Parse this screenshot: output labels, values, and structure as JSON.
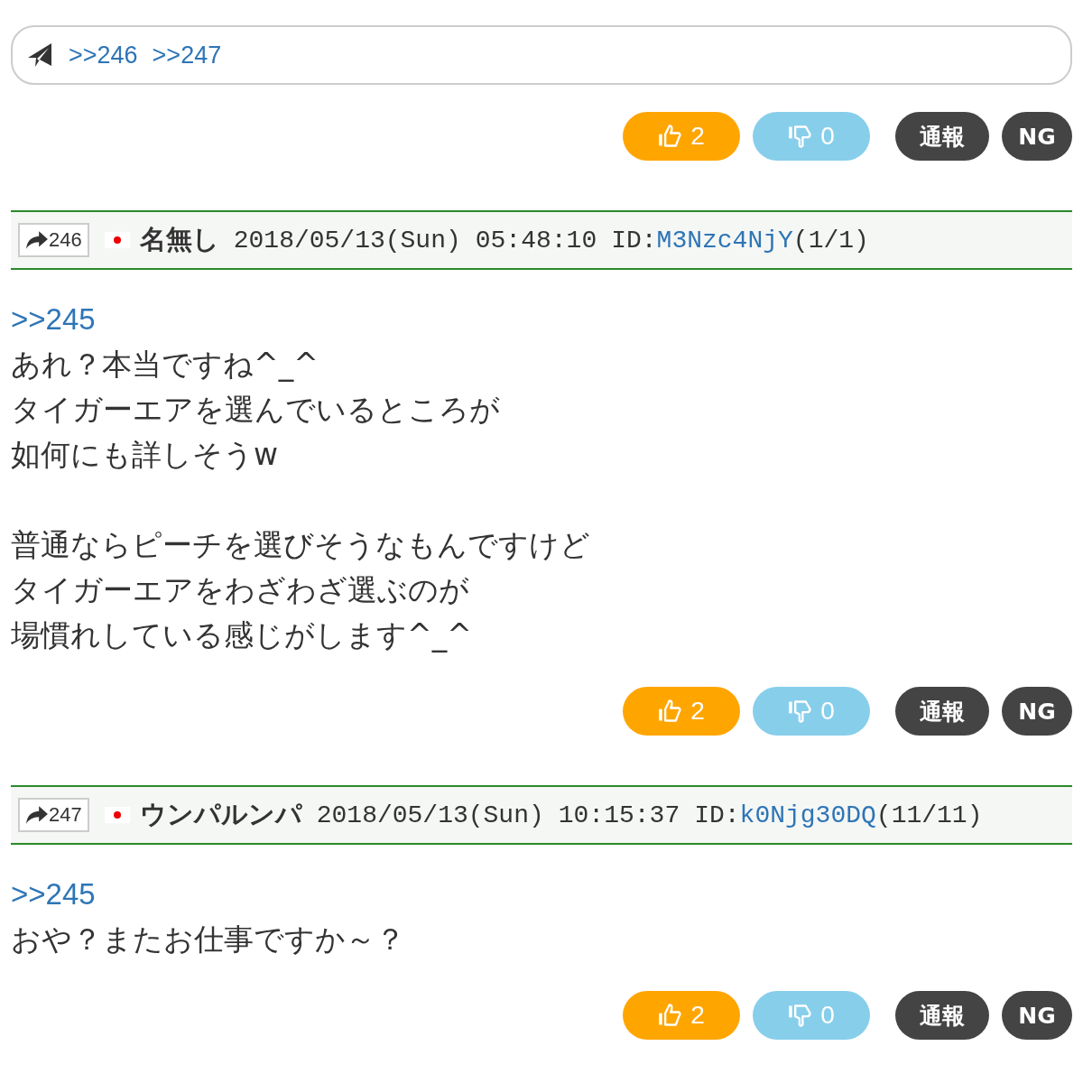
{
  "reply_bar": {
    "anchors": [
      ">>246",
      ">>247"
    ]
  },
  "top_actions": {
    "like": "2",
    "dislike": "0",
    "report": "通報",
    "ng": "NG"
  },
  "posts": [
    {
      "number": "246",
      "name": "名無し",
      "date": "2018/05/13(Sun)",
      "time": "05:48:10",
      "id_label": "ID:",
      "id": "M3Nzc4NjY",
      "count": "(1/1)",
      "anchor": ">>245",
      "paragraphs": [
        [
          "あれ？本当ですね^_^",
          "タイガーエアを選んでいるところが",
          "如何にも詳しそうw"
        ],
        [
          "普通ならピーチを選びそうなもんですけど",
          "タイガーエアをわざわざ選ぶのが",
          "場慣れしている感じがします^_^"
        ]
      ],
      "actions": {
        "like": "2",
        "dislike": "0",
        "report": "通報",
        "ng": "NG"
      }
    },
    {
      "number": "247",
      "name": "ウンパルンパ",
      "date": "2018/05/13(Sun)",
      "time": "10:15:37",
      "id_label": "ID:",
      "id": "k0Njg30DQ",
      "count": "(11/11)",
      "anchor": ">>245",
      "paragraphs": [
        [
          "おや？またお仕事ですか～？"
        ]
      ],
      "actions": {
        "like": "2",
        "dislike": "0",
        "report": "通報",
        "ng": "NG"
      }
    }
  ]
}
